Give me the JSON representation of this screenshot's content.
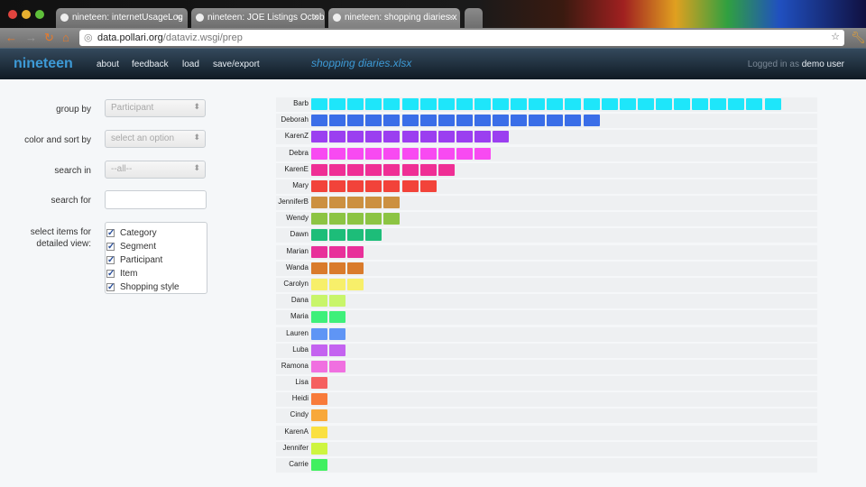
{
  "browser": {
    "tabs": [
      {
        "title": "nineteen: internetUsageLog"
      },
      {
        "title": "nineteen: JOE Listings Octob"
      },
      {
        "title": "nineteen: shopping diaries.x"
      }
    ],
    "url_host": "data.pollari.org",
    "url_path": "/dataviz.wsgi/prep"
  },
  "app": {
    "brand": "nineteen",
    "nav": [
      "about",
      "feedback",
      "load",
      "save/export"
    ],
    "document": "shopping diaries.xlsx",
    "login_prefix": "Logged in as",
    "user": "demo user"
  },
  "controls": {
    "group_by": {
      "label": "group by",
      "value": "Participant"
    },
    "color_sort": {
      "label": "color and sort by",
      "value": "select an option"
    },
    "search_in": {
      "label": "search in",
      "value": "--all--"
    },
    "search_for": {
      "label": "search for",
      "value": ""
    },
    "detail": {
      "label": "select items for detailed view:",
      "items": [
        {
          "label": "Category",
          "checked": true
        },
        {
          "label": "Segment",
          "checked": true
        },
        {
          "label": "Participant",
          "checked": true
        },
        {
          "label": "Item",
          "checked": true
        },
        {
          "label": "Shopping style",
          "checked": true
        }
      ]
    }
  },
  "chart_data": {
    "type": "bar",
    "categories": [
      "Barb",
      "Deborah",
      "KarenZ",
      "Debra",
      "KarenE",
      "Mary",
      "JenniferB",
      "Wendy",
      "Dawn",
      "Marian",
      "Wanda",
      "Carolyn",
      "Dana",
      "Maria",
      "Lauren",
      "Luba",
      "Ramona",
      "Lisa",
      "Heidi",
      "Cindy",
      "KarenA",
      "Jennifer",
      "Carrie"
    ],
    "values": [
      26,
      16,
      11,
      10,
      8,
      7,
      5,
      5,
      4,
      3,
      3,
      3,
      2,
      2,
      2,
      2,
      2,
      1,
      1,
      1,
      1,
      1,
      1
    ],
    "colors": [
      "#1ee6fa",
      "#3a6ee8",
      "#9b3ff0",
      "#f84af2",
      "#ef2f95",
      "#f2433a",
      "#cc9040",
      "#8cc443",
      "#1dbd79",
      "#e8309a",
      "#d97b2c",
      "#f7ef6a",
      "#c8f56a",
      "#3ef07a",
      "#5f95f5",
      "#c463f0",
      "#f070e0",
      "#f56060",
      "#f87b3a",
      "#f8a83a",
      "#fae040",
      "#cef540",
      "#40f060"
    ]
  }
}
